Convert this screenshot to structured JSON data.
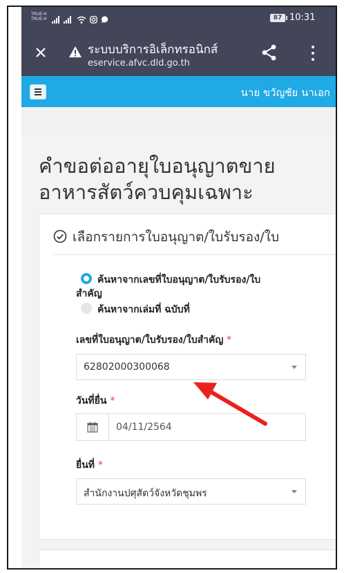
{
  "status_bar": {
    "carrier_line1": "TRUE-H",
    "carrier_line2": "TRUE-H",
    "battery": "87",
    "time": "10:31"
  },
  "toolbar": {
    "title": "ระบบบริการอิเล็กทรอนิกส์",
    "url": "eservice.afvc.dld.go.th",
    "icons": [
      "close-icon",
      "warning-icon",
      "share-icon",
      "more-vert-icon"
    ]
  },
  "navbar": {
    "user_name": "นาย ขวัญชัย นาเอก"
  },
  "page": {
    "title_line1": "คำขอต่ออายุใบอนุญาตขาย",
    "title_line2": "อาหารสัตว์ควบคุมเฉพาะ"
  },
  "card": {
    "heading": "เลือกรายการใบอนุญาต/ใบรับรอง/ใบ",
    "option1_line1": "ค้นหาจากเลขที่ใบอนุญาต/ใบรับรอง/ใบ",
    "option1_line2": "สำคัญ",
    "option2": "ค้นหาจากเล่มที่ ฉบับที่",
    "license_label": "เลขที่ใบอนุญาต/ใบรับรอง/ใบสำคัญ",
    "license_value": "62802000300068",
    "date_label": "วันที่ยื่น",
    "date_value": "04/11/2564",
    "office_label": "ยื่นที่",
    "office_value": "สำนักงานปศุสัตว์จังหวัดชุมพร",
    "required_mark": "*"
  },
  "colors": {
    "toolbar_bg": "#434559",
    "accent": "#1fa9e5",
    "required": "#e23b3b",
    "annotation_arrow": "#e8231f"
  }
}
